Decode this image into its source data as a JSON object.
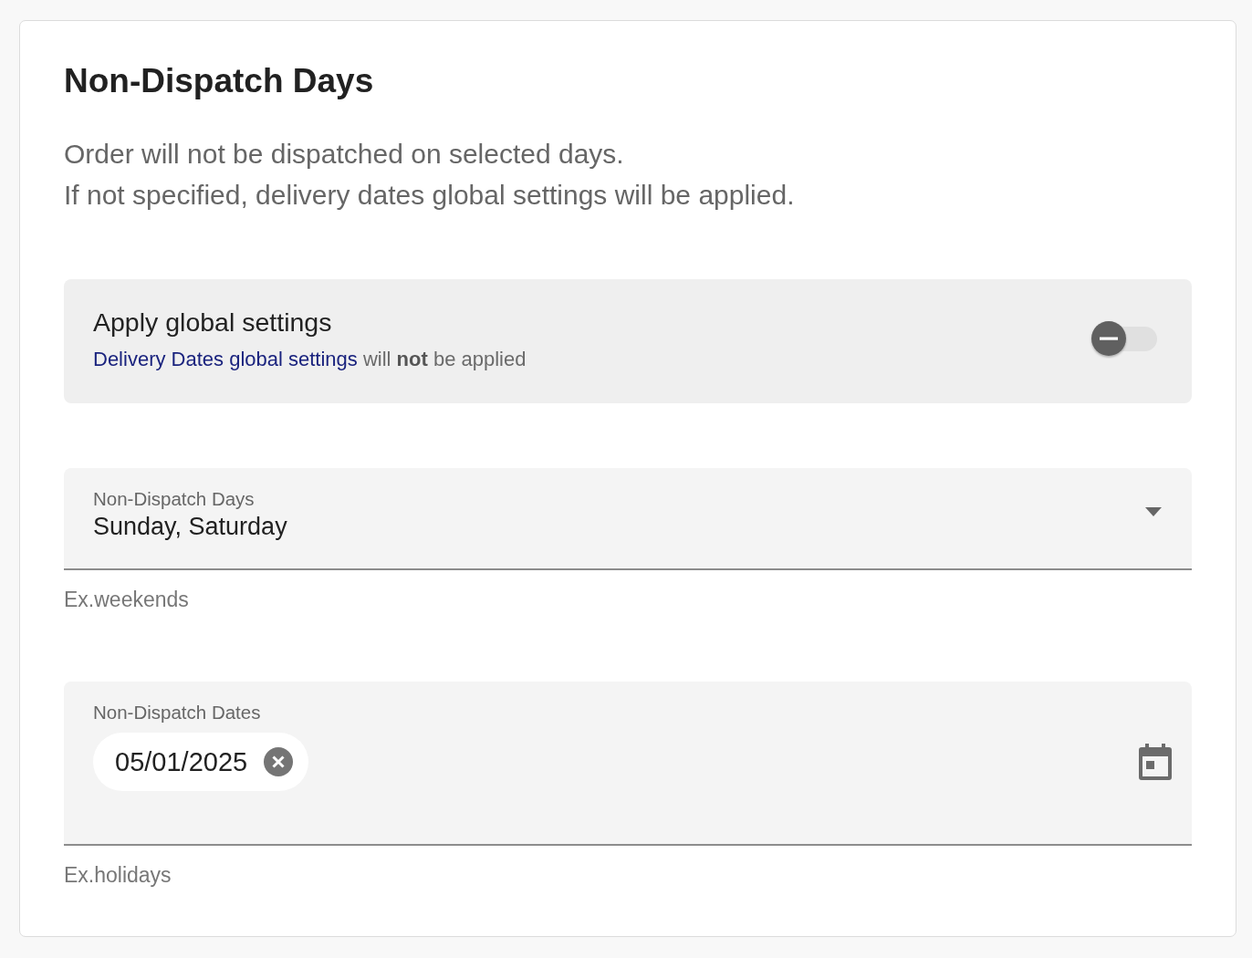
{
  "card": {
    "title": "Non-Dispatch Days",
    "description": [
      "Order will not be dispatched on selected days.",
      "If not specified, delivery dates global settings will be applied."
    ]
  },
  "global_settings": {
    "title": "Apply global settings",
    "link": "Delivery Dates global settings",
    "note": "will **not** be applied",
    "on": false
  },
  "days_field": {
    "label": "Non-Dispatch Days",
    "value": "Sunday, Saturday",
    "hint": "Ex.weekends"
  },
  "dates_field": {
    "label": "Non-Dispatch Dates",
    "chips": [
      "05/01/2025"
    ],
    "hint": "Ex.holidays"
  }
}
